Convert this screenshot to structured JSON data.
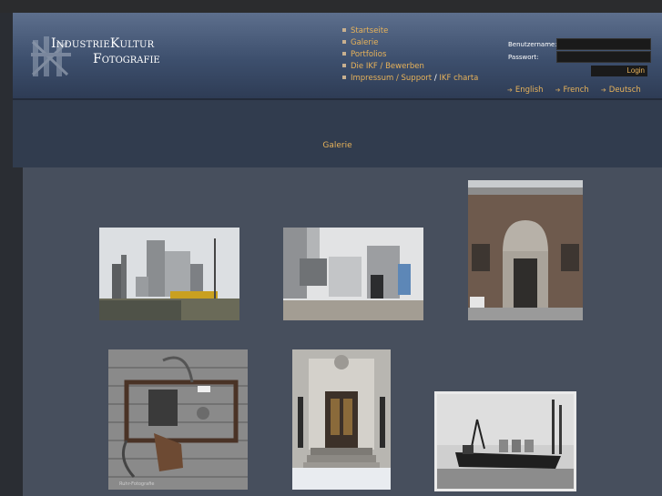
{
  "header": {
    "logo": {
      "line1": "IndustrieKultur",
      "line2": "Fotografie"
    },
    "nav": [
      {
        "label": "Startseite"
      },
      {
        "label": "Galerie"
      },
      {
        "label": "Portfolios"
      },
      {
        "label": "Die IKF / Bewerben"
      },
      {
        "label": "Impressum / Support",
        "separator": " / ",
        "label2": "IKF charta"
      }
    ],
    "login": {
      "username_label": "Benutzername:",
      "username_value": "",
      "password_label": "Passwort:",
      "password_value": "",
      "button": "Login"
    },
    "languages": [
      "English",
      "French",
      "Deutsch"
    ]
  },
  "main": {
    "title": "Galerie",
    "thumbnails": [
      {
        "subject": "industrial-plant-waterfront"
      },
      {
        "subject": "silos-factory-gate"
      },
      {
        "subject": "brick-gatehouse-facade"
      },
      {
        "subject": "electric-box-on-wall",
        "caption": "Ruhr-Fotografie"
      },
      {
        "subject": "art-deco-entrance-snow"
      },
      {
        "subject": "cargo-ship-harbor"
      }
    ]
  },
  "colors": {
    "accent": "#e7b25a",
    "header": "#4a5b78",
    "background": "#474f5d"
  }
}
